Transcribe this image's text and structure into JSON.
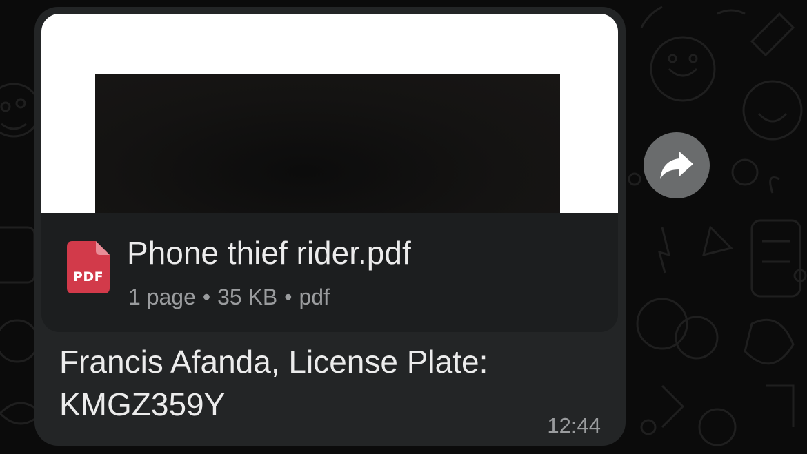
{
  "message": {
    "attachment": {
      "file_name": "Phone thief rider.pdf",
      "icon": "pdf-file-icon",
      "icon_label": "PDF",
      "pages": "1 page",
      "size": "35 KB",
      "type": "pdf",
      "separator": "•"
    },
    "caption_line1": "Francis Afanda, License Plate:",
    "caption_line2": "KMGZ359Y",
    "time": "12:44"
  },
  "actions": {
    "forward_icon": "forward-arrow-icon"
  },
  "colors": {
    "background": "#0b0b0b",
    "bubble": "#232526",
    "doc_card": "#1c1e1f",
    "pdf_icon": "#d23a4a",
    "text_primary": "#ececec",
    "text_secondary": "#9a9c9e",
    "forward_button": "#6a6c6d"
  }
}
